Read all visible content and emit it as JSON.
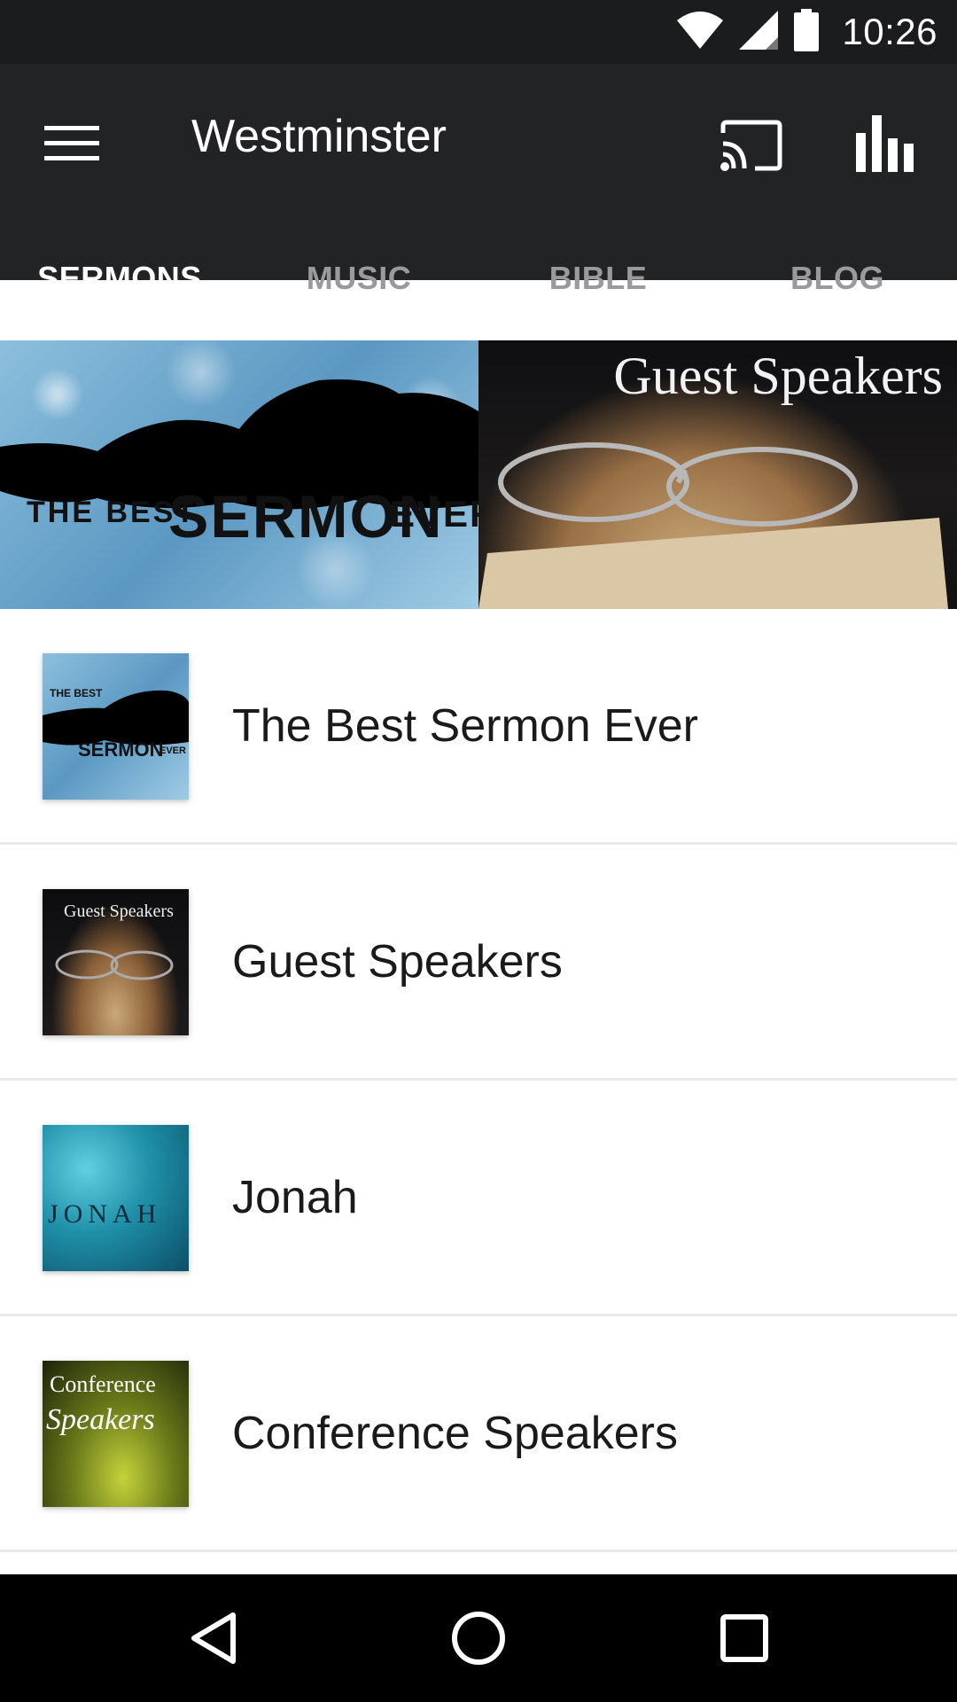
{
  "status_bar": {
    "time": "10:26",
    "icons": [
      "wifi-icon",
      "cell-signal-icon",
      "battery-icon"
    ]
  },
  "app_bar": {
    "title": "Westminster",
    "menu_icon": "menu-icon",
    "cast_icon": "cast-icon",
    "stats_icon": "equalizer-icon"
  },
  "tabs": [
    {
      "label": "SERMONS",
      "active": true
    },
    {
      "label": "MUSIC",
      "active": false
    },
    {
      "label": "BIBLE",
      "active": false
    },
    {
      "label": "BLOG",
      "active": false
    }
  ],
  "banner": {
    "left": {
      "text_small": "THE BEST",
      "text_big": "SERMON",
      "text_end": "EVER"
    },
    "right": {
      "text": "Guest Speakers"
    }
  },
  "list": [
    {
      "label": "The Best Sermon Ever",
      "thumb_text_1": "THE BEST",
      "thumb_text_2": "SERMON",
      "thumb_text_3": "EVER"
    },
    {
      "label": "Guest Speakers",
      "thumb_text_1": "Guest Speakers"
    },
    {
      "label": "Jonah",
      "thumb_text_1": "JONAH"
    },
    {
      "label": "Conference Speakers",
      "thumb_text_1": "Conference",
      "thumb_text_2": "Speakers"
    }
  ],
  "nav_bar": {
    "icons": [
      "back-icon",
      "home-icon",
      "recents-icon"
    ]
  },
  "colors": {
    "status_bar_bg": "#1b1c1e",
    "app_bar_bg": "#222325",
    "tab_active": "#ffffff",
    "tab_inactive": "#9a9a9c",
    "nav_bar_bg": "#000000"
  }
}
